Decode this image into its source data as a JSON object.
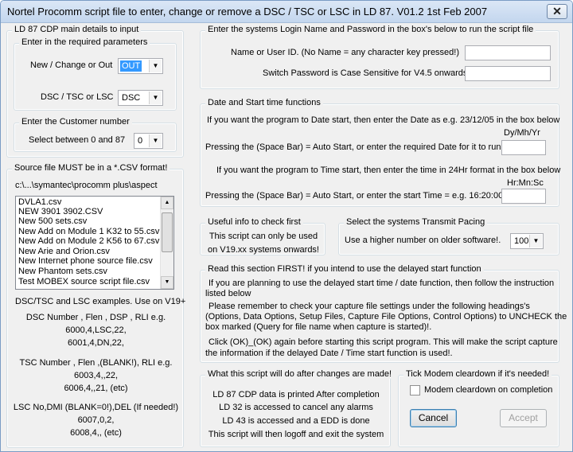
{
  "window": {
    "title": "Nortel Procomm script file to enter, change or remove a DSC / TSC or LSC in LD 87. V01.2 1st Feb 2007"
  },
  "cdp": {
    "title": "LD 87 CDP main details to input",
    "params": {
      "title": "Enter in the required parameters",
      "mode_label": "New / Change or Out",
      "mode_value": "OUT",
      "type_label": "DSC / TSC or LSC",
      "type_value": "DSC"
    },
    "customer": {
      "title": "Enter the Customer number",
      "label": "Select between 0 and 87",
      "value": "0"
    }
  },
  "source": {
    "title": "Source file MUST be in a *.CSV format!",
    "path": "c:\\...\\symantec\\procomm plus\\aspect",
    "files": [
      "DVLA1.csv",
      "NEW 3901 3902.CSV",
      "New 500 sets.csv",
      "New Add on Module 1 K32 to 55.csv",
      "New Add on Module 2 K56 to 67.csv",
      "New Arie and Orion.csv",
      "New Internet phone source file.csv",
      "New Phantom sets.csv",
      "Test MOBEX source script file.csv"
    ],
    "examples_heading": "DSC/TSC and LSC examples. Use on V19+",
    "dsc_header": "DSC Number , Flen , DSP , RLI  e.g.",
    "dsc_ex1": "6000,4,LSC,22,",
    "dsc_ex2": "6001,4,DN,22,",
    "tsc_header": "TSC Number , Flen ,(BLANK!), RLI  e.g.",
    "tsc_ex1": "6003,4,,22,",
    "tsc_ex2": "6006,4,,21,    (etc)",
    "lsc_header": "LSC No,DMI (BLANK=0!),DEL (If needed!)",
    "lsc_ex1": "6007,0,2,",
    "lsc_ex2": "6008,4,,     (etc)"
  },
  "login": {
    "title": "Enter the systems Login Name and Password in the box's below to run the script file",
    "user_label": "Name or User ID. (No Name = any character key pressed!)",
    "user_value": "",
    "pass_label": "Switch Password is Case Sensitive for V4.5 onwards",
    "pass_value": ""
  },
  "datetime": {
    "title": "Date and Start time functions",
    "date_info": "If you want the program to Date start, then enter the Date as e.g. 23/12/05 in the box below",
    "date_format": "Dy/Mh/Yr",
    "date_prompt": "Pressing the (Space Bar) = Auto Start, or enter the required Date for it to run",
    "date_value": "",
    "time_info": "If you want the program to Time start, then enter the time in 24Hr format in the box below",
    "time_format": "Hr:Mn:Sc",
    "time_prompt": "Pressing the (Space Bar) = Auto Start, or enter the start Time = e.g. 16:20:00",
    "time_value": ""
  },
  "useful": {
    "title": "Useful info to check first",
    "line1": "This script can only be used",
    "line2": "on V19.xx systems onwards!"
  },
  "pacing": {
    "title": "Select the systems Transmit Pacing",
    "label": "Use a higher number on older software!.",
    "value": "100"
  },
  "readme": {
    "title": "Read this section FIRST! if you intend to use the delayed start function",
    "p1a": "If you are planning to use the delayed start time / date function, then follow the instruction",
    "p1b": "listed below",
    "p2a": "Please remember to check your capture file settings under the following headings's",
    "p2b": "(Options, Data Options, Setup Files, Capture File Options, Control Options) to UNCHECK the",
    "p2c": "box marked (Query for file name when capture is started)!.",
    "p3a": "Click (OK)_(OK) again before starting this script program. This will make the script capture",
    "p3b": "the information if the delayed Date / Time start function is used!."
  },
  "whatdo": {
    "title": "What this script will do after changes are made!",
    "l1": "LD 87 CDP data is printed After completion",
    "l2": "LD 32 is accessed to cancel any alarms",
    "l3": "LD 43 is accessed and a EDD is done",
    "l4": "This script will then logoff and exit the system"
  },
  "modem": {
    "title": "Tick Modem cleardown if it's needed!",
    "check_label": "Modem cleardown on completion",
    "cancel": "Cancel",
    "accept": "Accept"
  }
}
